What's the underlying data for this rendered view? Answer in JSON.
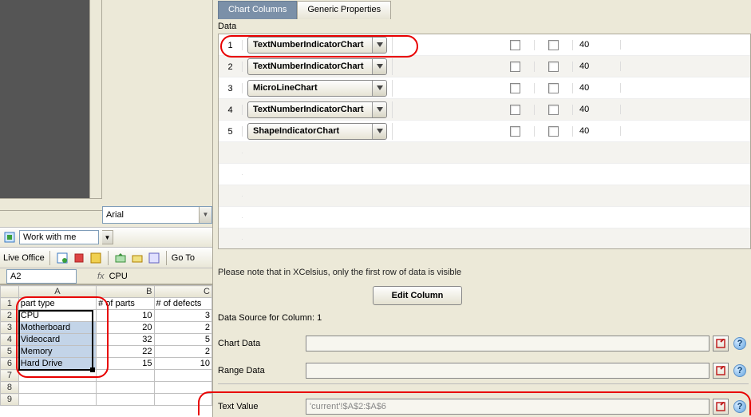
{
  "tabs": {
    "chart_columns": "Chart Columns",
    "generic_properties": "Generic Properties"
  },
  "data_label": "Data",
  "rows": [
    {
      "idx": "1",
      "type": "TextNumberIndicatorChart",
      "val": "40"
    },
    {
      "idx": "2",
      "type": "TextNumberIndicatorChart",
      "val": "40"
    },
    {
      "idx": "3",
      "type": "MicroLineChart",
      "val": "40"
    },
    {
      "idx": "4",
      "type": "TextNumberIndicatorChart",
      "val": "40"
    },
    {
      "idx": "5",
      "type": "ShapeIndicatorChart",
      "val": "40"
    }
  ],
  "note_text": "Please note that in XCelsius, only the first row of data is visible",
  "edit_column_btn": "Edit Column",
  "data_source_label": "Data Source for Column: 1",
  "fields": {
    "chart_data": "Chart Data",
    "range_data": "Range Data",
    "text_value": "Text Value",
    "text_value_val": "'current'!$A$2:$A$6"
  },
  "font_name": "Arial",
  "work_with_me": "Work with me",
  "live_office": "Live Office",
  "go_to": "Go To",
  "name_box": "A2",
  "fx_label": "fx",
  "fx_value": "CPU",
  "sheet": {
    "cols": [
      "A",
      "B",
      "C"
    ],
    "headers": {
      "A": "part type",
      "B": "# of parts",
      "C": "# of defects"
    },
    "rows": [
      {
        "num": "1"
      },
      {
        "num": "2",
        "A": "CPU",
        "B": "10",
        "C": "3"
      },
      {
        "num": "3",
        "A": "Motherboard",
        "B": "20",
        "C": "2"
      },
      {
        "num": "4",
        "A": "Videocard",
        "B": "32",
        "C": "5"
      },
      {
        "num": "5",
        "A": "Memory",
        "B": "22",
        "C": "2"
      },
      {
        "num": "6",
        "A": "Hard Drive",
        "B": "15",
        "C": "10"
      },
      {
        "num": "7"
      },
      {
        "num": "8"
      },
      {
        "num": "9"
      }
    ]
  }
}
